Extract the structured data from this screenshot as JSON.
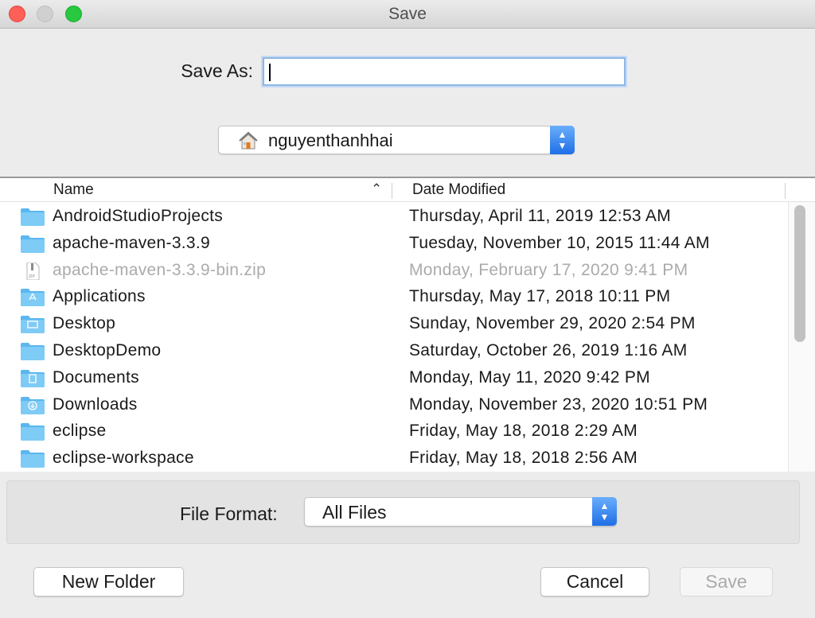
{
  "window": {
    "title": "Save"
  },
  "save_as": {
    "label": "Save As:",
    "value": ""
  },
  "location": {
    "label": "nguyenthanhhai",
    "icon": "home-icon"
  },
  "file_list": {
    "columns": {
      "name": "Name",
      "date": "Date Modified"
    },
    "rows": [
      {
        "name": "AndroidStudioProjects",
        "date": "Thursday, April 11, 2019 12:53 AM",
        "icon": "folder-icon",
        "enabled": true
      },
      {
        "name": "apache-maven-3.3.9",
        "date": "Tuesday, November 10, 2015 11:44 AM",
        "icon": "folder-icon",
        "enabled": true
      },
      {
        "name": "apache-maven-3.3.9-bin.zip",
        "date": "Monday, February 17, 2020 9:41 PM",
        "icon": "zip-file-icon",
        "enabled": false
      },
      {
        "name": "Applications",
        "date": "Thursday, May 17, 2018 10:11 PM",
        "icon": "applications-folder-icon",
        "enabled": true
      },
      {
        "name": "Desktop",
        "date": "Sunday, November 29, 2020 2:54 PM",
        "icon": "desktop-folder-icon",
        "enabled": true
      },
      {
        "name": "DesktopDemo",
        "date": "Saturday, October 26, 2019 1:16 AM",
        "icon": "folder-icon",
        "enabled": true
      },
      {
        "name": "Documents",
        "date": "Monday, May 11, 2020 9:42 PM",
        "icon": "documents-folder-icon",
        "enabled": true
      },
      {
        "name": "Downloads",
        "date": "Monday, November 23, 2020 10:51 PM",
        "icon": "downloads-folder-icon",
        "enabled": true
      },
      {
        "name": "eclipse",
        "date": "Friday, May 18, 2018 2:29 AM",
        "icon": "folder-icon",
        "enabled": true
      },
      {
        "name": "eclipse-workspace",
        "date": "Friday, May 18, 2018 2:56 AM",
        "icon": "folder-icon",
        "enabled": true
      }
    ]
  },
  "file_format": {
    "label": "File Format:",
    "value": "All Files"
  },
  "buttons": {
    "new_folder": "New Folder",
    "cancel": "Cancel",
    "save": "Save"
  },
  "colors": {
    "folder": "#5ab7f0",
    "accent": "#1e6fe6",
    "disabled_text": "#ababab"
  }
}
